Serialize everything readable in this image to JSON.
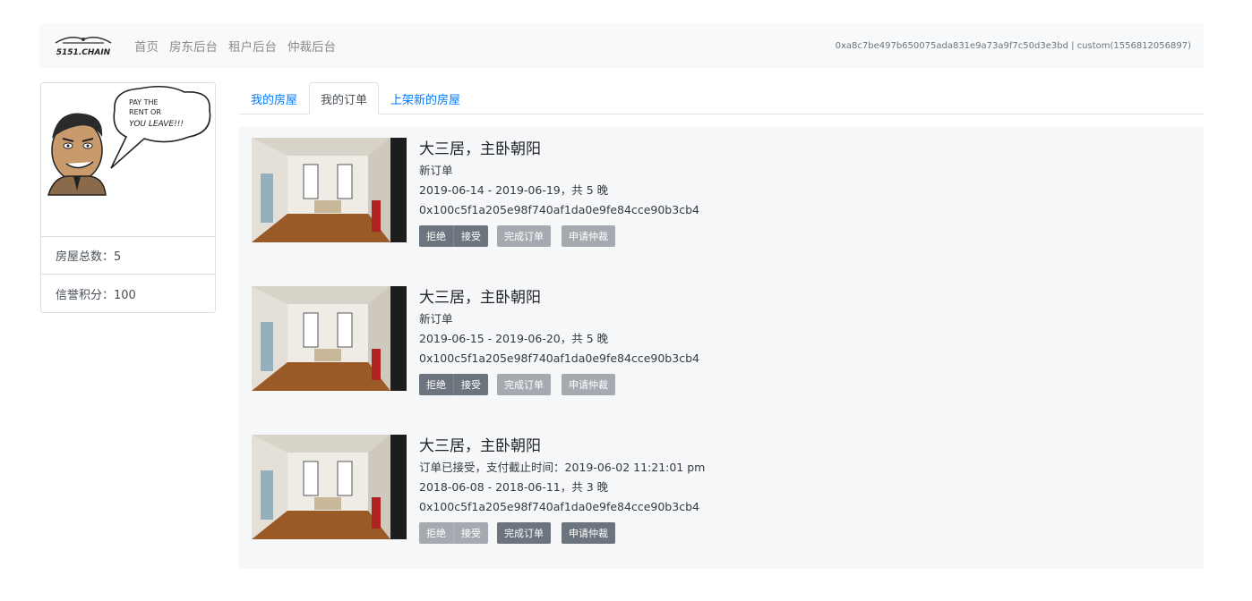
{
  "navbar": {
    "brand_text": "5151.CHAIN",
    "links": [
      "首页",
      "房东后台",
      "租户后台",
      "仲裁后台"
    ],
    "account": "0xa8c7be497b650075ada831e9a73a9f7c50d3e3bd | custom(1556812056897)"
  },
  "profile": {
    "speech": [
      "PAY THE",
      "RENT OR",
      "YOU LEAVE!!!"
    ],
    "house_count_label": "房屋总数：5",
    "credit_label": "信誉积分：100"
  },
  "tabs": [
    "我的房屋",
    "我的订单",
    "上架新的房屋"
  ],
  "orders": [
    {
      "title": "大三居，主卧朝阳",
      "status": "新订单",
      "dates": "2019-06-14 - 2019-06-19，共 5 晚",
      "hash": "0x100c5f1a205e98f740af1da0e9fe84cce90b3cb4",
      "buttons": {
        "reject": "拒绝",
        "accept": "接受",
        "complete": "完成订单",
        "arbitrate": "申请仲裁"
      }
    },
    {
      "title": "大三居，主卧朝阳",
      "status": "新订单",
      "dates": "2019-06-15 - 2019-06-20，共 5 晚",
      "hash": "0x100c5f1a205e98f740af1da0e9fe84cce90b3cb4",
      "buttons": {
        "reject": "拒绝",
        "accept": "接受",
        "complete": "完成订单",
        "arbitrate": "申请仲裁"
      }
    },
    {
      "title": "大三居，主卧朝阳",
      "status": "订单已接受，支付截止时间：2019-06-02 11:21:01 pm",
      "dates": "2018-06-08 - 2018-06-11，共 3 晚",
      "hash": "0x100c5f1a205e98f740af1da0e9fe84cce90b3cb4",
      "buttons": {
        "reject": "拒绝",
        "accept": "接受",
        "complete": "完成订单",
        "arbitrate": "申请仲裁"
      }
    }
  ],
  "colors": {
    "link": "#007bff",
    "button": "#6c757d",
    "button_disabled": "#a5aab0",
    "navbar_bg": "#f8f9fa"
  }
}
